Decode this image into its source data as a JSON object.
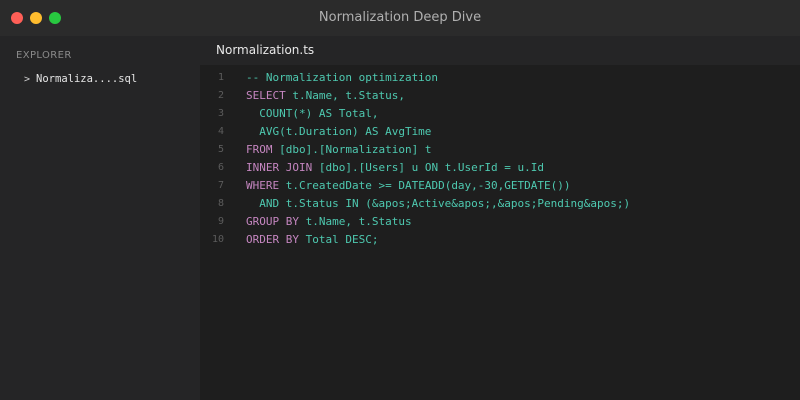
{
  "window": {
    "title": "Normalization Deep Dive"
  },
  "sidebar": {
    "header": "EXPLORER",
    "files": [
      {
        "chevron": ">",
        "name": "Normaliza....sql"
      }
    ]
  },
  "editor": {
    "tab": {
      "label": "Normalization.ts"
    },
    "lines": [
      {
        "num": "1",
        "tokens": [
          {
            "t": "cm",
            "v": "-- Normalization optimization"
          }
        ]
      },
      {
        "num": "2",
        "tokens": [
          {
            "t": "kw",
            "v": "SELECT "
          },
          {
            "t": "txt",
            "v": "t.Name, t.Status,"
          }
        ]
      },
      {
        "num": "3",
        "tokens": [
          {
            "t": "txt",
            "v": "  COUNT(*) AS Total,"
          }
        ]
      },
      {
        "num": "4",
        "tokens": [
          {
            "t": "txt",
            "v": "  AVG(t.Duration) AS AvgTime"
          }
        ]
      },
      {
        "num": "5",
        "tokens": [
          {
            "t": "kw",
            "v": "FROM "
          },
          {
            "t": "txt",
            "v": "[dbo].[Normalization] t"
          }
        ]
      },
      {
        "num": "6",
        "tokens": [
          {
            "t": "kw",
            "v": "INNER JOIN "
          },
          {
            "t": "txt",
            "v": "[dbo].[Users] u ON t.UserId = u.Id"
          }
        ]
      },
      {
        "num": "7",
        "tokens": [
          {
            "t": "kw",
            "v": "WHERE "
          },
          {
            "t": "txt",
            "v": "t.CreatedDate >= DATEADD(day,-30,GETDATE())"
          }
        ]
      },
      {
        "num": "8",
        "tokens": [
          {
            "t": "txt",
            "v": "  AND t.Status IN (&apos;Active&apos;,&apos;Pending&apos;)"
          }
        ]
      },
      {
        "num": "9",
        "tokens": [
          {
            "t": "kw",
            "v": "GROUP BY "
          },
          {
            "t": "txt",
            "v": "t.Name, t.Status"
          }
        ]
      },
      {
        "num": "10",
        "tokens": [
          {
            "t": "kw",
            "v": "ORDER BY "
          },
          {
            "t": "txt",
            "v": "Total DESC;"
          }
        ]
      }
    ]
  },
  "colors": {
    "keyword": "#c586c0",
    "text": "#4ec9b0",
    "titlebar": "#2b2b2b",
    "sidebar": "#252526",
    "editor": "#1e1e1e"
  }
}
